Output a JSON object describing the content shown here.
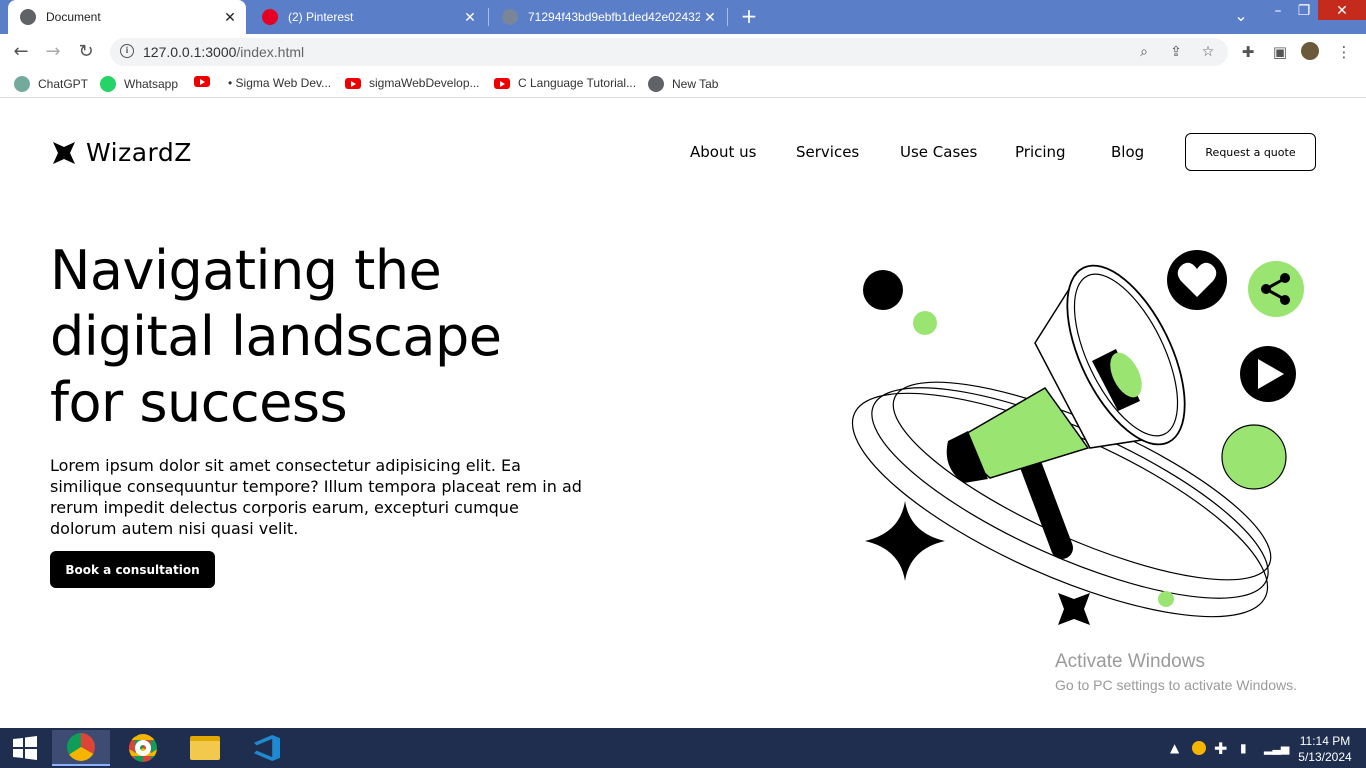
{
  "browser": {
    "tabs": [
      {
        "title": "Document",
        "active": true
      },
      {
        "title": "(2) Pinterest",
        "active": false
      },
      {
        "title": "71294f43bd9ebfb1ded42e02432",
        "active": false
      }
    ],
    "new_tab_icon": "+",
    "window_controls": {
      "minimize": "–",
      "restore": "❐",
      "close": "✕",
      "tab_search": "⌄"
    },
    "address": {
      "host": "127.0.0.1:3000",
      "path": "/index.html"
    },
    "bookmarks": [
      {
        "label": "ChatGPT",
        "icon": "chatgpt-icon"
      },
      {
        "label": "Whatsapp",
        "icon": "whatsapp-icon"
      },
      {
        "label": "",
        "icon": "youtube-icon"
      },
      {
        "label": "• Sigma Web Dev...",
        "icon": "none"
      },
      {
        "label": "sigmaWebDevelop...",
        "icon": "youtube-icon"
      },
      {
        "label": "C Language Tutorial...",
        "icon": "youtube-icon"
      },
      {
        "label": "New Tab",
        "icon": "globe-icon"
      }
    ]
  },
  "site": {
    "logo": "WizardZ",
    "nav": [
      "About us",
      "Services",
      "Use Cases",
      "Pricing",
      "Blog"
    ],
    "quote_button": "Request a quote",
    "hero": {
      "title_lines": [
        "Navigating the",
        "digital landscape",
        "for success"
      ],
      "description": "Lorem ipsum dolor sit amet consectetur adipisicing elit. Ea similique consequuntur tempore? Illum tempora placeat rem in ad rerum impedit delectus corporis earum, excepturi cumque dolorum autem nisi quasi velit.",
      "cta": "Book a consultation"
    },
    "colors": {
      "accent": "#9ae472",
      "ink": "#000000",
      "background": "#ffffff"
    }
  },
  "watermark": {
    "line1": "Activate Windows",
    "line2": "Go to PC settings to activate Windows."
  },
  "taskbar": {
    "time": "11:14 PM",
    "date": "5/13/2024"
  }
}
